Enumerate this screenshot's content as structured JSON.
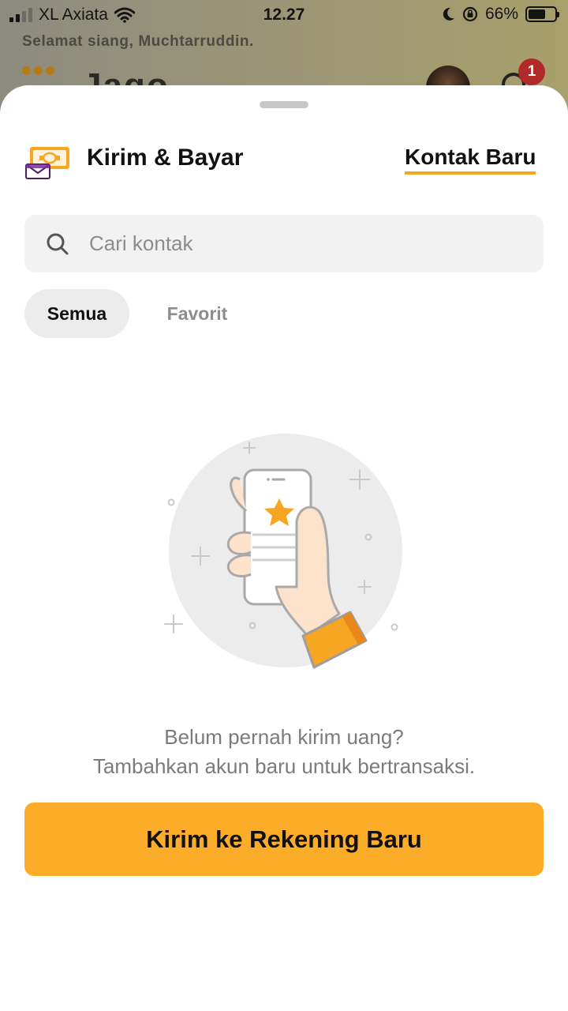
{
  "status_bar": {
    "carrier": "XL Axiata",
    "time": "12.27",
    "battery": "66%",
    "battery_level": 0.66
  },
  "background_app": {
    "greeting": "Selamat siang, Muchtarruddin.",
    "logo_text": "Jago",
    "notification_count": "1"
  },
  "sheet": {
    "title": "Kirim & Bayar",
    "new_contact_label": "Kontak Baru",
    "search": {
      "placeholder": "Cari kontak",
      "value": ""
    },
    "tabs": [
      {
        "label": "Semua",
        "active": true
      },
      {
        "label": "Favorit",
        "active": false
      }
    ],
    "empty_state": {
      "title": "Belum pernah kirim uang?",
      "subtitle": "Tambahkan akun baru untuk bertransaksi."
    },
    "cta_label": "Kirim ke Rekening Baru"
  },
  "colors": {
    "accent": "#fbad29",
    "underline": "#f6a623",
    "badge": "#b02a2a"
  },
  "icons": [
    "send-money-icon",
    "search-icon",
    "phone-star-illustration",
    "bell-icon",
    "wifi-icon",
    "moon-icon",
    "rotation-lock-icon"
  ]
}
